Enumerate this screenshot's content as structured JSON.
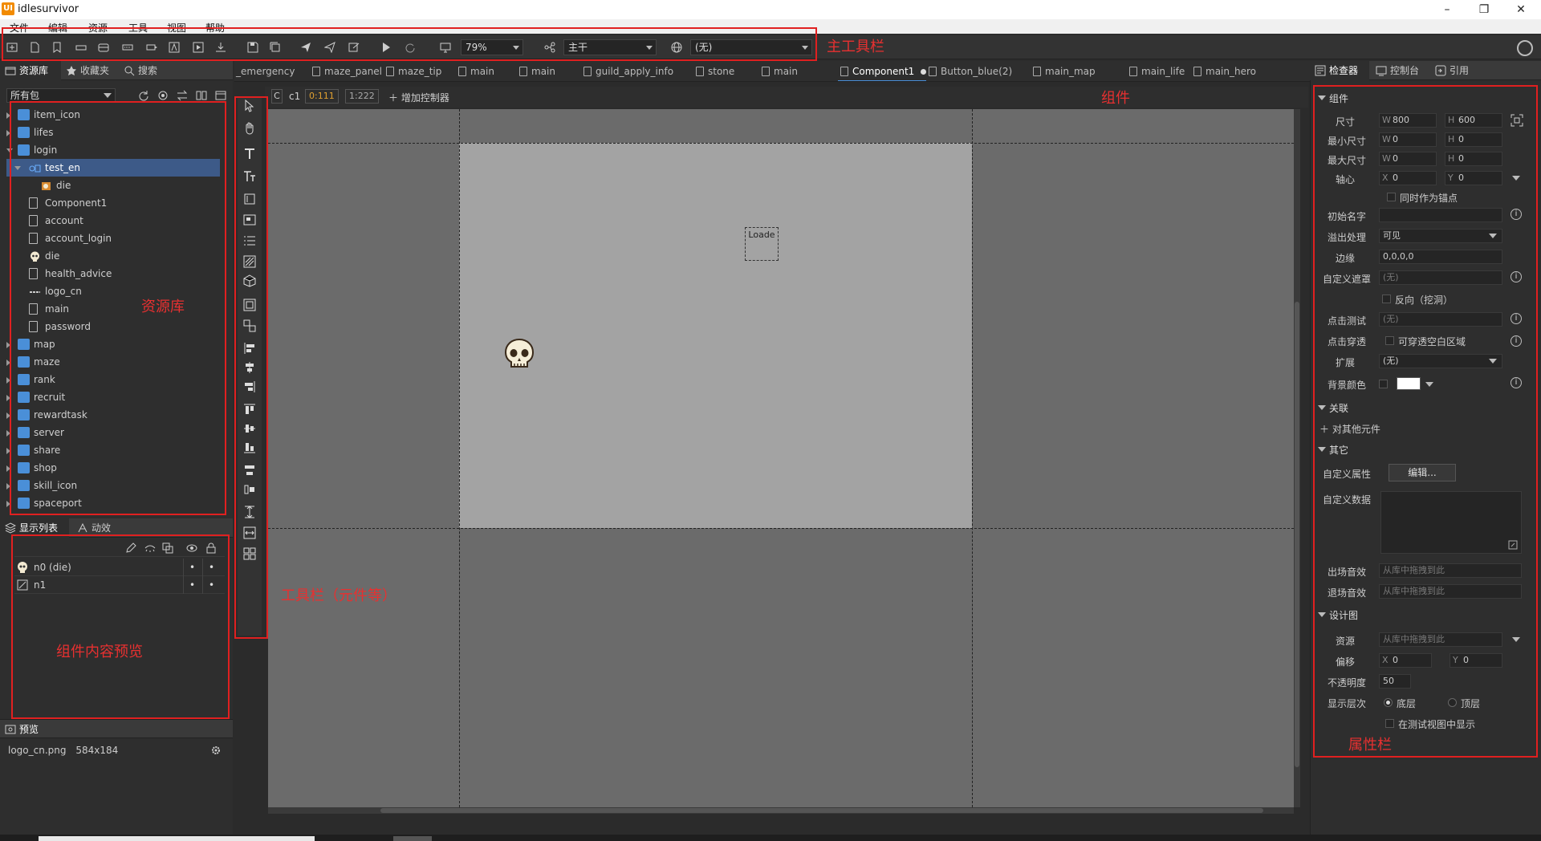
{
  "window": {
    "logo": "UI",
    "title": "idlesurvivor",
    "min": "–",
    "max": "❐",
    "close": "✕"
  },
  "menu": [
    "文件",
    "编辑",
    "资源",
    "工具",
    "视图",
    "帮助"
  ],
  "toolbar": {
    "zoom": "79%",
    "branch": "主干",
    "language": "(无)"
  },
  "annotations": {
    "main_toolbar": "主工具栏",
    "component": "组件",
    "library": "资源库",
    "tools": "工具栏（元件等）",
    "preview_content": "组件内容预览",
    "properties": "属性栏"
  },
  "library": {
    "tabs": [
      "资源库",
      "收藏夹",
      "搜索"
    ],
    "filter": "所有包",
    "items": [
      {
        "label": "item_icon",
        "type": "folder",
        "depth": 0
      },
      {
        "label": "lifes",
        "type": "folder",
        "depth": 0
      },
      {
        "label": "login",
        "type": "folder",
        "depth": 0,
        "open": true
      },
      {
        "label": "test_en",
        "type": "component",
        "depth": 1,
        "open": true,
        "selected": true
      },
      {
        "label": "die",
        "type": "image",
        "depth": 2
      },
      {
        "label": "Component1",
        "type": "doc",
        "depth": 1
      },
      {
        "label": "account",
        "type": "doc",
        "depth": 1
      },
      {
        "label": "account_login",
        "type": "doc",
        "depth": 1
      },
      {
        "label": "die",
        "type": "skull",
        "depth": 1
      },
      {
        "label": "health_advice",
        "type": "doc",
        "depth": 1
      },
      {
        "label": "logo_cn",
        "type": "logo",
        "depth": 1
      },
      {
        "label": "main",
        "type": "doc",
        "depth": 1
      },
      {
        "label": "password",
        "type": "doc",
        "depth": 1
      },
      {
        "label": "map",
        "type": "folder",
        "depth": 0
      },
      {
        "label": "maze",
        "type": "folder",
        "depth": 0
      },
      {
        "label": "rank",
        "type": "folder",
        "depth": 0
      },
      {
        "label": "recruit",
        "type": "folder",
        "depth": 0
      },
      {
        "label": "rewardtask",
        "type": "folder",
        "depth": 0
      },
      {
        "label": "server",
        "type": "folder",
        "depth": 0
      },
      {
        "label": "share",
        "type": "folder",
        "depth": 0
      },
      {
        "label": "shop",
        "type": "folder",
        "depth": 0
      },
      {
        "label": "skill_icon",
        "type": "folder",
        "depth": 0
      },
      {
        "label": "spaceport",
        "type": "folder",
        "depth": 0
      }
    ]
  },
  "displaylist": {
    "tabs": [
      "显示列表",
      "动效"
    ],
    "rows": [
      {
        "label": "n0 (die)",
        "dot1": "•",
        "dot2": "•"
      },
      {
        "label": "n1",
        "dot1": "•",
        "dot2": "•"
      }
    ]
  },
  "preview": {
    "title": "预览",
    "file": "logo_cn.png",
    "size": "584x184"
  },
  "doctabs": [
    {
      "label": "_emergency"
    },
    {
      "label": "maze_panel"
    },
    {
      "label": "maze_tip"
    },
    {
      "label": "main"
    },
    {
      "label": "main"
    },
    {
      "label": "guild_apply_info"
    },
    {
      "label": "stone"
    },
    {
      "label": "main"
    },
    {
      "label": "Component1",
      "active": true
    },
    {
      "label": "Button_blue(2)"
    },
    {
      "label": "main_map"
    },
    {
      "label": "main_life"
    },
    {
      "label": "main_hero"
    }
  ],
  "controller": {
    "c": "C",
    "name": "c1",
    "page": "0:111",
    "page2": "1:222",
    "add": "增加控制器"
  },
  "canvas": {
    "loader": "Loade"
  },
  "inspector": {
    "tabs": [
      "检查器",
      "控制台",
      "引用"
    ],
    "sections": {
      "component": "组件",
      "relation": "关联",
      "other": "其它",
      "design": "设计图"
    },
    "size": {
      "label": "尺寸",
      "w": "800",
      "h": "600"
    },
    "minsize": {
      "label": "最小尺寸",
      "w": "0",
      "h": "0"
    },
    "maxsize": {
      "label": "最大尺寸",
      "w": "0",
      "h": "0"
    },
    "pivot": {
      "label": "轴心",
      "x": "0",
      "y": "0",
      "anchor": "同时作为锚点"
    },
    "initname": {
      "label": "初始名字",
      "value": ""
    },
    "overflow": {
      "label": "溢出处理",
      "value": "可见"
    },
    "margin": {
      "label": "边缘",
      "value": "0,0,0,0"
    },
    "mask": {
      "label": "自定义遮罩",
      "value": "(无)",
      "reverse": "反向（挖洞）"
    },
    "hittest": {
      "label": "点击测试",
      "value": "(无)"
    },
    "clickthrough": {
      "label": "点击穿透",
      "option": "可穿透空白区域"
    },
    "extend": {
      "label": "扩展",
      "value": "(无)"
    },
    "bgcolor": {
      "label": "背景颜色",
      "color": "#ffffff"
    },
    "relation_add": "对其他元件",
    "customprop": {
      "label": "自定义属性",
      "button": "编辑..."
    },
    "customdata": {
      "label": "自定义数据"
    },
    "enter_sound": {
      "label": "出场音效",
      "placeholder": "从库中拖拽到此"
    },
    "exit_sound": {
      "label": "退场音效",
      "placeholder": "从库中拖拽到此"
    },
    "design_res": {
      "label": "资源",
      "placeholder": "从库中拖拽到此"
    },
    "offset": {
      "label": "偏移",
      "x": "0",
      "y": "0"
    },
    "opacity": {
      "label": "不透明度",
      "value": "50"
    },
    "layer": {
      "label": "显示层次",
      "bottom": "底层",
      "top": "顶层",
      "testview": "在测试视图中显示"
    },
    "axes": {
      "w": "W",
      "h": "H",
      "x": "X",
      "y": "Y"
    }
  },
  "colors": {
    "accent": "#4a8fd8",
    "annotation": "#e02020",
    "stage": "#a3a3a3",
    "canvas": "#6b6b6b"
  }
}
